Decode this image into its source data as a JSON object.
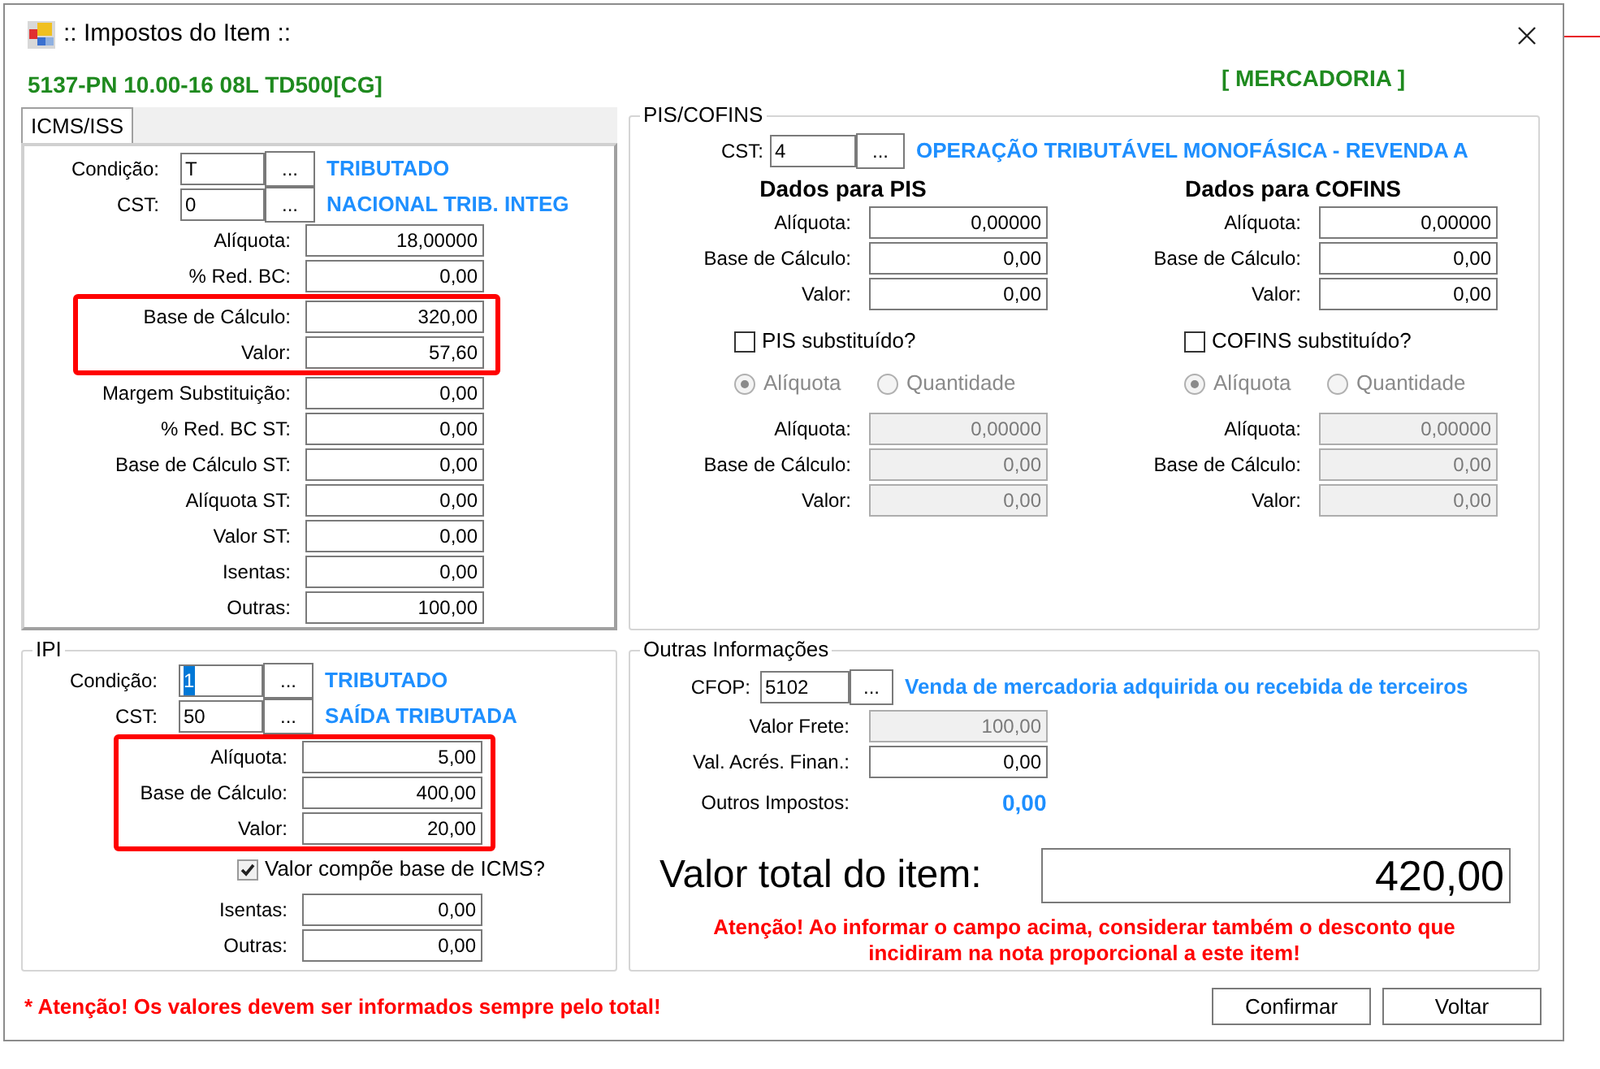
{
  "window": {
    "title": ":: Impostos do Item ::"
  },
  "product": "5137-PN 10.00-16 08L TD500[CG]",
  "category": "[ MERCADORIA ]",
  "tabs": [
    {
      "label": "ICMS/ISS",
      "selected": true
    }
  ],
  "icms": {
    "codes": [
      {
        "label": "Condição:",
        "value": "T",
        "picker": "...",
        "description": "TRIBUTADO",
        "text_selected": false
      },
      {
        "label": "CST:",
        "value": "0",
        "picker": "...",
        "description": "NACIONAL TRIB. INTEG",
        "text_selected": false
      }
    ],
    "fields": [
      {
        "label": "Alíquota:",
        "value": "18,00000",
        "highlighted": false
      },
      {
        "label": "% Red. BC:",
        "value": "0,00",
        "highlighted": false
      },
      {
        "label": "Base de Cálculo:",
        "value": "320,00",
        "highlighted": true
      },
      {
        "label": "Valor:",
        "value": "57,60",
        "highlighted": true
      },
      {
        "label": "Margem Substituição:",
        "value": "0,00",
        "highlighted": false
      },
      {
        "label": "% Red. BC ST:",
        "value": "0,00",
        "highlighted": false
      },
      {
        "label": "Base de Cálculo ST:",
        "value": "0,00",
        "highlighted": false
      },
      {
        "label": "Alíquota ST:",
        "value": "0,00",
        "highlighted": false
      },
      {
        "label": "Valor ST:",
        "value": "0,00",
        "highlighted": false
      },
      {
        "label": "Isentas:",
        "value": "0,00",
        "highlighted": false
      },
      {
        "label": "Outras:",
        "value": "100,00",
        "highlighted": false
      }
    ]
  },
  "pis_cofins": {
    "title": "PIS/COFINS",
    "cst": {
      "label": "CST:",
      "value": "4",
      "picker": "...",
      "description": "OPERAÇÃO TRIBUTÁVEL MONOFÁSICA - REVENDA A",
      "text_selected": false
    },
    "columns": [
      {
        "heading": "Dados para PIS",
        "fields": [
          {
            "label": "Alíquota:",
            "value": "0,00000",
            "disabled": false
          },
          {
            "label": "Base de Cálculo:",
            "value": "0,00",
            "disabled": false
          },
          {
            "label": "Valor:",
            "value": "0,00",
            "disabled": false
          }
        ],
        "substitute": {
          "label": "PIS substituído?",
          "checked": false
        },
        "modes": [
          {
            "label": "Alíquota",
            "selected": true
          },
          {
            "label": "Quantidade",
            "selected": false
          }
        ],
        "substitute_fields": [
          {
            "label": "Alíquota:",
            "value": "0,00000",
            "disabled": true
          },
          {
            "label": "Base de Cálculo:",
            "value": "0,00",
            "disabled": true
          },
          {
            "label": "Valor:",
            "value": "0,00",
            "disabled": true
          }
        ]
      },
      {
        "heading": "Dados para COFINS",
        "fields": [
          {
            "label": "Alíquota:",
            "value": "0,00000",
            "disabled": false
          },
          {
            "label": "Base de Cálculo:",
            "value": "0,00",
            "disabled": false
          },
          {
            "label": "Valor:",
            "value": "0,00",
            "disabled": false
          }
        ],
        "substitute": {
          "label": "COFINS substituído?",
          "checked": false
        },
        "modes": [
          {
            "label": "Alíquota",
            "selected": true
          },
          {
            "label": "Quantidade",
            "selected": false
          }
        ],
        "substitute_fields": [
          {
            "label": "Alíquota:",
            "value": "0,00000",
            "disabled": true
          },
          {
            "label": "Base de Cálculo:",
            "value": "0,00",
            "disabled": true
          },
          {
            "label": "Valor:",
            "value": "0,00",
            "disabled": true
          }
        ]
      }
    ]
  },
  "ipi": {
    "title": "IPI",
    "codes": [
      {
        "label": "Condição:",
        "value": "1",
        "picker": "...",
        "description": "TRIBUTADO",
        "text_selected": true
      },
      {
        "label": "CST:",
        "value": "50",
        "picker": "...",
        "description": "SAÍDA TRIBUTADA",
        "text_selected": false
      }
    ],
    "fields": [
      {
        "label": "Alíquota:",
        "value": "5,00",
        "highlighted": true
      },
      {
        "label": "Base de Cálculo:",
        "value": "400,00",
        "highlighted": true
      },
      {
        "label": "Valor:",
        "value": "20,00",
        "highlighted": true
      }
    ],
    "compose": {
      "label": "Valor compõe base de ICMS?",
      "checked": true
    },
    "extra_fields": [
      {
        "label": "Isentas:",
        "value": "0,00",
        "highlighted": false
      },
      {
        "label": "Outras:",
        "value": "0,00",
        "highlighted": false
      }
    ]
  },
  "other": {
    "title": "Outras Informações",
    "cfop": {
      "label": "CFOP:",
      "value": "5102",
      "picker": "...",
      "description": "Venda de mercadoria adquirida ou recebida de terceiros",
      "text_selected": false
    },
    "fields": [
      {
        "label": "Valor Frete:",
        "value": "100,00",
        "disabled": true
      },
      {
        "label": "Val. Acrés. Finan.:",
        "value": "0,00",
        "disabled": false
      }
    ],
    "other_taxes": {
      "label": "Outros Impostos:",
      "value": "0,00"
    },
    "total": {
      "label": "Valor total do item:",
      "value": "420,00"
    },
    "warning": "Atenção! Ao informar o campo acima, considerar também o desconto que incidiram na nota proporcional a este item!"
  },
  "footer_warning": "* Atenção! Os valores devem ser informados sempre pelo total!",
  "buttons": [
    "Confirmar",
    "Voltar"
  ]
}
